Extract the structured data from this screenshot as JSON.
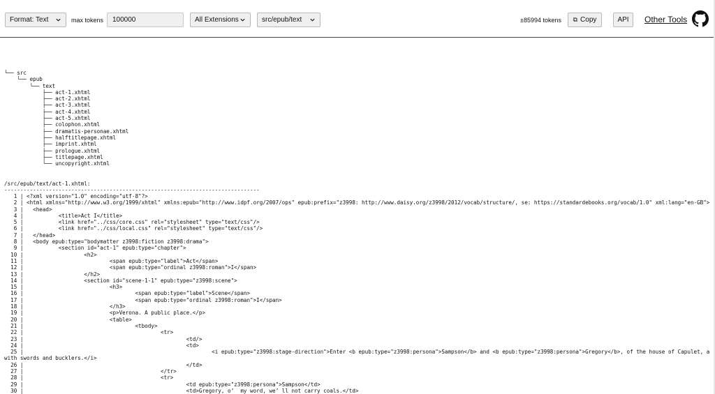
{
  "toolbar": {
    "format_select": "Format: Text",
    "max_tokens_label": "max tokens",
    "max_tokens_value": "100000",
    "extensions_select": "All Extensions",
    "path_select": "src/epub/text",
    "token_count": "±85994 tokens",
    "copy_label": "Copy",
    "api_label": "API",
    "other_tools_label": "Other Tools"
  },
  "tree": [
    "└── src",
    "    └── epub",
    "        └── text",
    "            ├── act-1.xhtml",
    "            ├── act-2.xhtml",
    "            ├── act-3.xhtml",
    "            ├── act-4.xhtml",
    "            ├── act-5.xhtml",
    "            ├── colophon.xhtml",
    "            ├── dramatis-personae.xhtml",
    "            ├── halftitlepage.xhtml",
    "            ├── imprint.xhtml",
    "            ├── prologue.xhtml",
    "            ├── titlepage.xhtml",
    "            └── uncopyright.xhtml"
  ],
  "file_header": "/src/epub/text/act-1.xhtml:",
  "separator": "--------------------------------------------------------------------------------",
  "code_lines": [
    "   1 | <?xml version=\"1.0\" encoding=\"utf-8\"?>",
    "   2 | <html xmlns=\"http://www.w3.org/1999/xhtml\" xmlns:epub=\"http://www.idpf.org/2007/ops\" epub:prefix=\"z3998: http://www.daisy.org/z3998/2012/vocab/structure/, se: https://standardebooks.org/vocab/1.0\" xml:lang=\"en-GB\">",
    "   3 |   <head>",
    "   4 |           <title>Act I</title>",
    "   5 |           <link href=\"../css/core.css\" rel=\"stylesheet\" type=\"text/css\"/>",
    "   6 |           <link href=\"../css/local.css\" rel=\"stylesheet\" type=\"text/css\"/>",
    "   7 |   </head>",
    "   8 |   <body epub:type=\"bodymatter z3998:fiction z3998:drama\">",
    "   9 |           <section id=\"act-1\" epub:type=\"chapter\">",
    "  10 |                   <h2>",
    "  11 |                           <span epub:type=\"label\">Act</span>",
    "  12 |                           <span epub:type=\"ordinal z3998:roman\">I</span>",
    "  13 |                   </h2>",
    "  14 |                   <section id=\"scene-1-1\" epub:type=\"z3998:scene\">",
    "  15 |                           <h3>",
    "  16 |                                   <span epub:type=\"label\">Scene</span>",
    "  17 |                                   <span epub:type=\"ordinal z3998:roman\">I</span>",
    "  18 |                           </h3>",
    "  19 |                           <p>Verona. A public place.</p>",
    "  20 |                           <table>",
    "  21 |                                   <tbody>",
    "  22 |                                           <tr>",
    "  23 |                                                   <td/>",
    "  24 |                                                   <td>",
    "  25 |                                                           <i epub:type=\"z3998:stage-direction\">Enter <b epub:type=\"z3998:persona\">Sampson</b> and <b epub:type=\"z3998:persona\">Gregory</b>, of the house of Capulet, armed",
    "with swords and bucklers.</i>",
    "  26 |                                                   </td>",
    "  27 |                                           </tr>",
    "  28 |                                           <tr>",
    "  29 |                                                   <td epub:type=\"z3998:persona\">Sampson</td>",
    "  30 |                                                   <td>Gregory, o’  my word, we’ ll not carry coals.</td>"
  ]
}
